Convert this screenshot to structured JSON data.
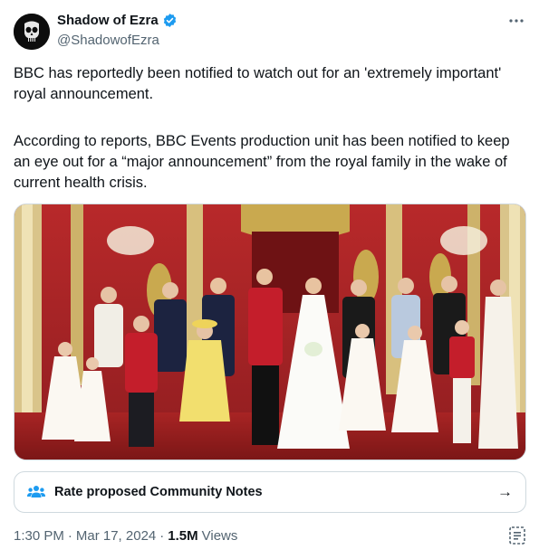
{
  "author": {
    "display_name": "Shadow of Ezra",
    "handle": "@ShadowofEzra",
    "avatar_icon": "punisher-skull-icon",
    "verified_icon": "verified-badge-icon",
    "verified_color": "#1d9bf0"
  },
  "more_icon": "more-options-icon",
  "tweet": {
    "paragraph_1": "BBC has reportedly been notified to watch out for an 'extremely important' royal announcement.",
    "paragraph_2": "According to reports, BBC Events production unit has been notified to keep an eye out for a “major announcement” from the royal family in the wake of current health crisis."
  },
  "community_notes": {
    "label": "Rate proposed Community Notes",
    "icon": "community-notes-people-icon",
    "icon_color": "#1d9bf0",
    "arrow": "→"
  },
  "meta": {
    "time": "1:30 PM",
    "sep1": "·",
    "date": "Mar 17, 2024",
    "sep2": "·",
    "views_count": "1.5M",
    "views_label": "Views"
  },
  "analytics_icon": "post-analytics-icon"
}
